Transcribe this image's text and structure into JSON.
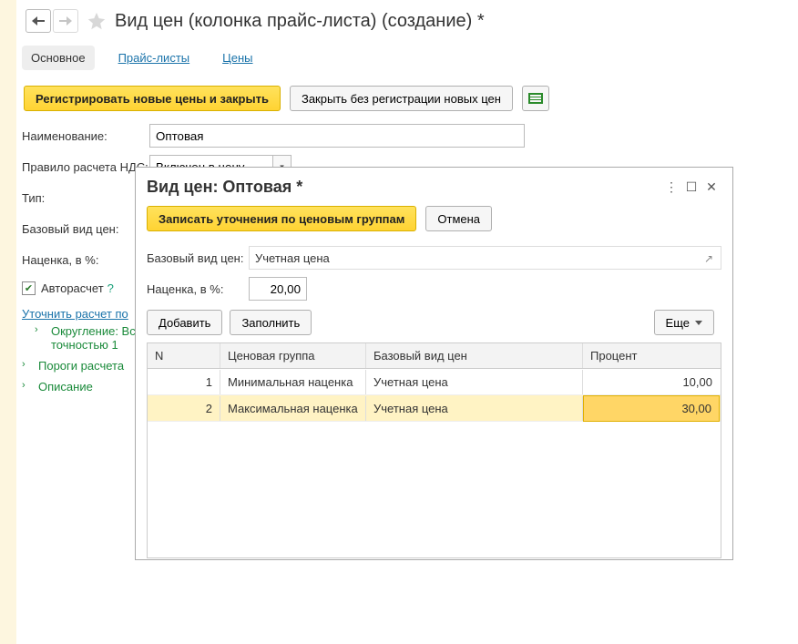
{
  "header": {
    "title": "Вид цен (колонка прайс-листа) (создание) *"
  },
  "tabs": {
    "main": "Основное",
    "priceLists": "Прайс-листы",
    "prices": "Цены"
  },
  "toolbar": {
    "register": "Регистрировать новые цены и закрыть",
    "closeNoReg": "Закрыть без регистрации новых цен"
  },
  "form": {
    "name_label": "Наименование:",
    "name_value": "Оптовая",
    "vat_label": "Правило расчета НДС:",
    "vat_value": "Включен в цену",
    "type_label": "Тип:",
    "base_label": "Базовый вид цен:",
    "markup_label": "Наценка, в %:",
    "autocalc_label": "Авторасчет",
    "refine_link": "Уточнить расчет по"
  },
  "tree": {
    "rounding": "Округление: Вс",
    "rounding2": "точностью 1",
    "thresholds": "Пороги расчета",
    "description": "Описание"
  },
  "dialog": {
    "title": "Вид цен: Оптовая *",
    "save": "Записать уточнения по ценовым группам",
    "cancel": "Отмена",
    "base_label": "Базовый вид цен:",
    "base_value": "Учетная цена",
    "markup_label": "Наценка, в %:",
    "markup_value": "20,00",
    "add": "Добавить",
    "fill": "Заполнить",
    "more": "Еще",
    "columns": {
      "n": "N",
      "group": "Ценовая группа",
      "base": "Базовый вид цен",
      "percent": "Процент"
    },
    "rows": [
      {
        "n": "1",
        "group": "Минимальная наценка",
        "base": "Учетная цена",
        "percent": "10,00"
      },
      {
        "n": "2",
        "group": "Максимальная наценка",
        "base": "Учетная цена",
        "percent": "30,00"
      }
    ]
  }
}
